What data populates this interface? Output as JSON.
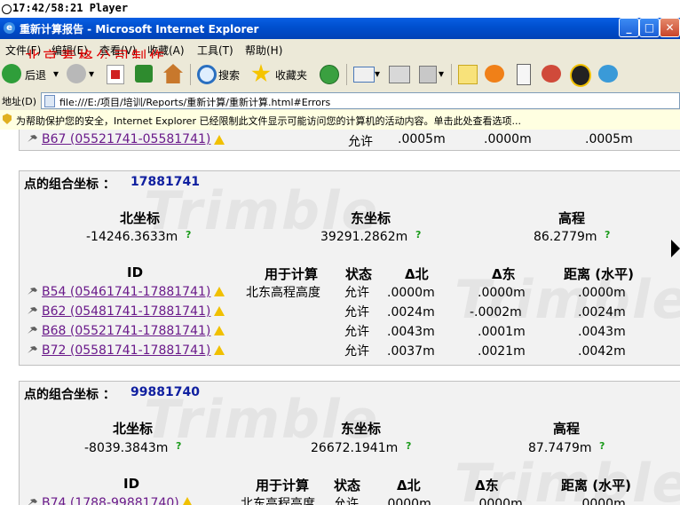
{
  "player": {
    "time": "17:42/58:21 Player"
  },
  "window": {
    "title": "重新计算报告 - Microsoft Internet Explorer"
  },
  "menu": [
    "文件(F)",
    "编辑(E)",
    "查看(V)",
    "收藏(A)",
    "工具(T)",
    "帮助(H)"
  ],
  "watermark_text": "北京麦格公司制作",
  "toolbar": {
    "back": "后退",
    "search": "搜索",
    "favorites": "收藏夹"
  },
  "address": {
    "label": "地址(D)",
    "url": "file:///E:/项目/培训/Reports/重新计算/重新计算.html#Errors"
  },
  "infobar": {
    "text": "为帮助保护您的安全，Internet Explorer 已经限制此文件显示可能访问您的计算机的活动内容。单击此处查看选项..."
  },
  "top_row": {
    "link": "B67 (05521741-05581741)",
    "status": "允许",
    "dn": ".0005m",
    "de": ".0000m",
    "dist": ".0005m"
  },
  "panels": [
    {
      "label": "点的组合坐标 ：",
      "id": "17881741",
      "north_label": "北坐标",
      "east_label": "东坐标",
      "elev_label": "高程",
      "north": "-14246.3633m",
      "east": "39291.2862m",
      "elev": "86.2779m",
      "columns": [
        "ID",
        "用于计算",
        "状态",
        "Δ北",
        "Δ东",
        "距离 (水平)"
      ],
      "rows": [
        {
          "link": "B54 (05461741-17881741)",
          "use": "北东高程高度",
          "status": "允许",
          "dn": ".0000m",
          "de": ".0000m",
          "dist": ".0000m"
        },
        {
          "link": "B62 (05481741-17881741)",
          "use": "",
          "status": "允许",
          "dn": ".0024m",
          "de": "-.0002m",
          "dist": ".0024m"
        },
        {
          "link": "B68 (05521741-17881741)",
          "use": "",
          "status": "允许",
          "dn": ".0043m",
          "de": ".0001m",
          "dist": ".0043m"
        },
        {
          "link": "B72 (05581741-17881741)",
          "use": "",
          "status": "允许",
          "dn": ".0037m",
          "de": ".0021m",
          "dist": ".0042m"
        }
      ]
    },
    {
      "label": "点的组合坐标 ：",
      "id": "99881740",
      "north_label": "北坐标",
      "east_label": "东坐标",
      "elev_label": "高程",
      "north": "-8039.3843m",
      "east": "26672.1941m",
      "elev": "87.7479m",
      "columns": [
        "ID",
        "用于计算",
        "状态",
        "Δ北",
        "Δ东",
        "距离 (水平)"
      ],
      "rows": [
        {
          "link": "B74 (1788-99881740)",
          "use": "北东高程高度",
          "status": "允许",
          "dn": ".0000m",
          "de": ".0000m",
          "dist": ".0000m"
        }
      ]
    }
  ],
  "help_mark": "?",
  "watermark_logo": "Trimble"
}
